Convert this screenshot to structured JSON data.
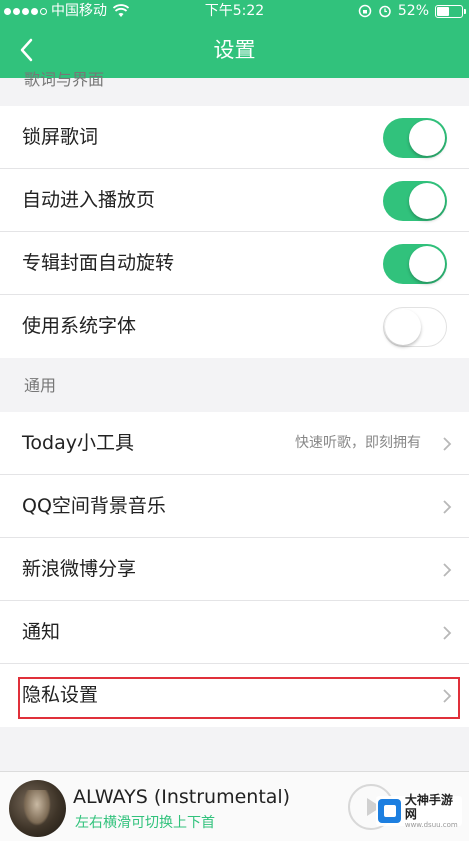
{
  "status_bar": {
    "carrier": "中国移动",
    "time": "下午5:22",
    "battery": "52%",
    "battery_level": 0.52
  },
  "nav": {
    "title": "设置"
  },
  "sections": {
    "lyrics_clipped": "歌词与界面",
    "general": "通用"
  },
  "toggle_rows": [
    {
      "label": "锁屏歌词",
      "on": true
    },
    {
      "label": "自动进入播放页",
      "on": true
    },
    {
      "label": "专辑封面自动旋转",
      "on": true
    },
    {
      "label": "使用系统字体",
      "on": false
    }
  ],
  "general_rows": [
    {
      "label": "Today小工具",
      "hint": "快速听歌，即刻拥有"
    },
    {
      "label": "QQ空间背景音乐"
    },
    {
      "label": "新浪微博分享"
    },
    {
      "label": "通知"
    },
    {
      "label": "隐私设置"
    }
  ],
  "player": {
    "title": "ALWAYS (Instrumental)",
    "subtitle": "左右横滑可切换上下首"
  },
  "watermark": {
    "main": "大神手游网",
    "sub": "www.dsuu.com"
  },
  "colors": {
    "accent": "#31c27c",
    "highlight": "#e0303a"
  }
}
